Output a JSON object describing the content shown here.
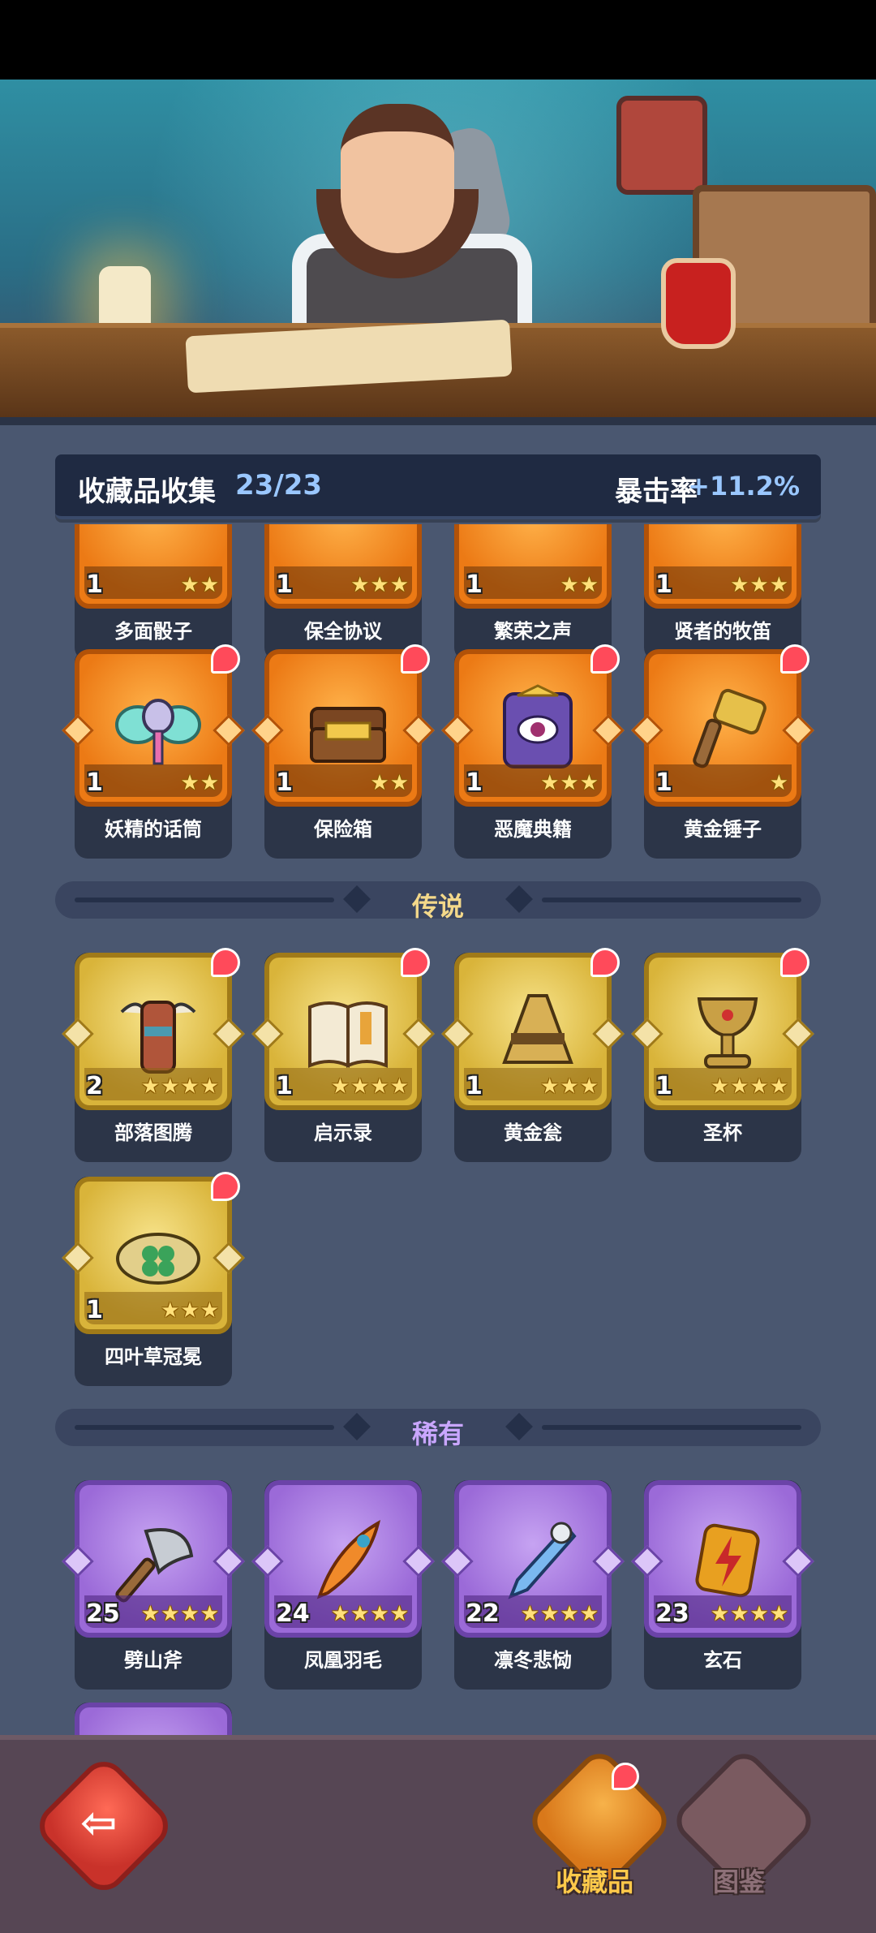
{
  "header": {
    "title": "收藏品收集",
    "count": "23/23",
    "crit_label": "暴击率",
    "crit_value": "+11.2%"
  },
  "sections": {
    "legend": {
      "label": "传说",
      "color": "#f3d88a"
    },
    "rare": {
      "label": "稀有",
      "color": "#c9a6ff"
    }
  },
  "epic_row1": [
    {
      "name": "多面骰子",
      "level": "1",
      "stars": 2
    },
    {
      "name": "保全协议",
      "level": "1",
      "stars": 3
    },
    {
      "name": "繁荣之声",
      "level": "1",
      "stars": 2
    },
    {
      "name": "贤者的牧笛",
      "level": "1",
      "stars": 3
    }
  ],
  "epic_row2": [
    {
      "name": "妖精的话筒",
      "level": "1",
      "stars": 2,
      "icon": "butterfly-mic-icon"
    },
    {
      "name": "保险箱",
      "level": "1",
      "stars": 2,
      "icon": "treasure-chest-icon"
    },
    {
      "name": "恶魔典籍",
      "level": "1",
      "stars": 3,
      "icon": "demon-book-icon"
    },
    {
      "name": "黄金锤子",
      "level": "1",
      "stars": 1,
      "icon": "golden-hammer-icon"
    }
  ],
  "legend_items": [
    {
      "name": "部落图腾",
      "level": "2",
      "stars": 4,
      "icon": "tribal-totem-icon"
    },
    {
      "name": "启示录",
      "level": "1",
      "stars": 4,
      "icon": "open-book-icon"
    },
    {
      "name": "黄金瓮",
      "level": "1",
      "stars": 3,
      "icon": "golden-urn-icon"
    },
    {
      "name": "圣杯",
      "level": "1",
      "stars": 4,
      "icon": "holy-grail-icon"
    },
    {
      "name": "四叶草冠冕",
      "level": "1",
      "stars": 3,
      "icon": "clover-crown-icon"
    }
  ],
  "rare_items": [
    {
      "name": "劈山斧",
      "level": "25",
      "stars": 4,
      "icon": "axe-icon"
    },
    {
      "name": "凤凰羽毛",
      "level": "24",
      "stars": 4,
      "icon": "phoenix-feather-icon"
    },
    {
      "name": "凛冬悲恸",
      "level": "22",
      "stars": 4,
      "icon": "frost-sword-icon"
    },
    {
      "name": "玄石",
      "level": "23",
      "stars": 4,
      "icon": "lightning-stone-icon"
    }
  ],
  "nav": {
    "collection": "收藏品",
    "codex": "图鉴"
  }
}
